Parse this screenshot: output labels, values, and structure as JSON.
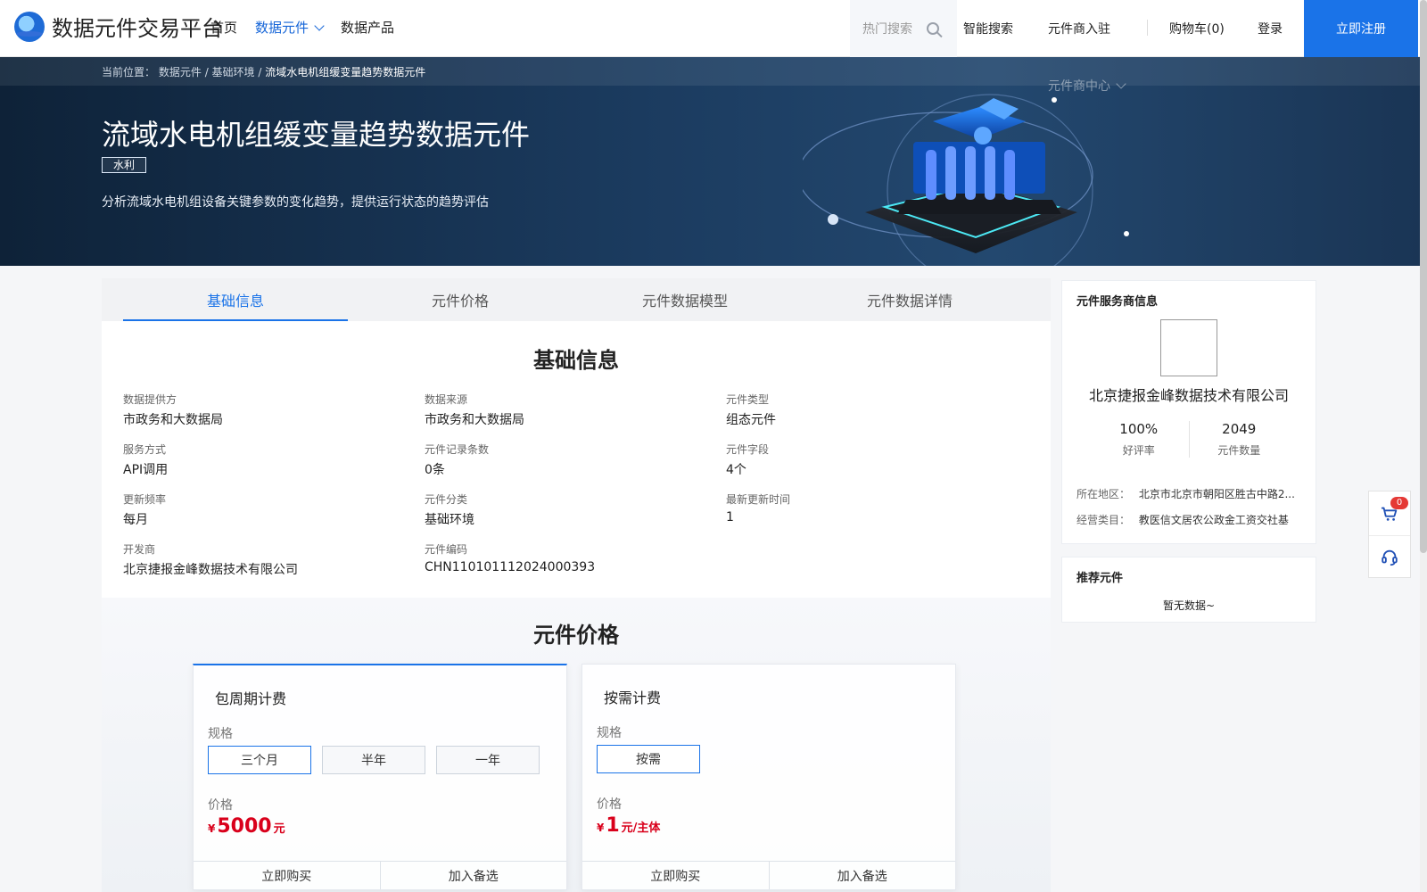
{
  "header": {
    "brand": "数据元件交易平台",
    "nav": [
      {
        "label": "首页"
      },
      {
        "label": "数据元件"
      },
      {
        "label": "数据产品"
      }
    ],
    "search_placeholder": "热门搜索",
    "smart_search": "智能搜索",
    "vendor_join": "元件商入驻",
    "cart": "购物车(0)",
    "login": "登录",
    "register": "立即注册",
    "vendor_center": "元件商中心"
  },
  "hero": {
    "breadcrumb_prefix": "当前位置：",
    "breadcrumb_1": "数据元件",
    "breadcrumb_2": "基础环境",
    "breadcrumb_current": "流域水电机组缓变量趋势数据元件",
    "title": "流域水电机组缓变量趋势数据元件",
    "tag": "水利",
    "description": "分析流域水电机组设备关键参数的变化趋势，提供运行状态的趋势评估"
  },
  "tabs": [
    {
      "label": "基础信息"
    },
    {
      "label": "元件价格"
    },
    {
      "label": "元件数据模型"
    },
    {
      "label": "元件数据详情"
    }
  ],
  "basic_info": {
    "title": "基础信息",
    "fields": [
      {
        "label": "数据提供方",
        "value": "市政务和大数据局"
      },
      {
        "label": "数据来源",
        "value": "市政务和大数据局"
      },
      {
        "label": "元件类型",
        "value": "组态元件"
      },
      {
        "label": "服务方式",
        "value": "API调用"
      },
      {
        "label": "元件记录条数",
        "value": "0条"
      },
      {
        "label": "元件字段",
        "value": "4个"
      },
      {
        "label": "更新频率",
        "value": "每月"
      },
      {
        "label": "元件分类",
        "value": "基础环境"
      },
      {
        "label": "最新更新时间",
        "value": "1"
      },
      {
        "label": "开发商",
        "value": "北京捷报金峰数据技术有限公司"
      },
      {
        "label": "元件编码",
        "value": "CHN110101112024000393"
      }
    ]
  },
  "pricing": {
    "title": "元件价格",
    "spec_label": "规格",
    "price_label": "价格",
    "buy": "立即购买",
    "add": "加入备选",
    "periodic": {
      "title": "包周期计费",
      "options": [
        "三个月",
        "半年",
        "一年"
      ],
      "currency": "¥",
      "amount": "5000",
      "unit": "元"
    },
    "ondemand": {
      "title": "按需计费",
      "options": [
        "按需"
      ],
      "currency": "¥",
      "amount": "1",
      "unit": "元/主体"
    }
  },
  "sidebar": {
    "vendor_title": "元件服务商信息",
    "company": "北京捷报金峰数据技术有限公司",
    "good_rate": "100%",
    "good_rate_label": "好评率",
    "component_count": "2049",
    "component_count_label": "元件数量",
    "region_label": "所在地区：",
    "region": "北京市北京市朝阳区胜古中路2...",
    "category_label": "经营类目：",
    "category": "教医信文居农公政金工资交社基",
    "recommend_title": "推荐元件",
    "no_data": "暂无数据~"
  },
  "floating": {
    "cart_count": "0"
  }
}
